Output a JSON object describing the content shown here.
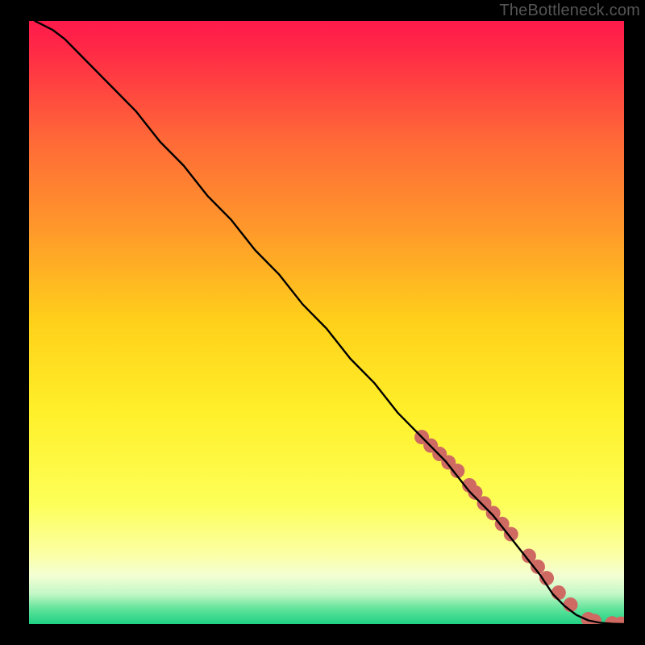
{
  "watermark": "TheBottleneck.com",
  "chart_data": {
    "type": "line",
    "title": "",
    "xlabel": "",
    "ylabel": "",
    "xlim": [
      0,
      100
    ],
    "ylim": [
      0,
      100
    ],
    "gradient_stops": [
      {
        "offset": 0,
        "color": "#ff1a4b"
      },
      {
        "offset": 0.05,
        "color": "#ff2a46"
      },
      {
        "offset": 0.2,
        "color": "#ff6a37"
      },
      {
        "offset": 0.35,
        "color": "#ff9a2a"
      },
      {
        "offset": 0.5,
        "color": "#ffd11a"
      },
      {
        "offset": 0.65,
        "color": "#fff02a"
      },
      {
        "offset": 0.8,
        "color": "#fdff58"
      },
      {
        "offset": 0.88,
        "color": "#fcffa0"
      },
      {
        "offset": 0.92,
        "color": "#f3ffd4"
      },
      {
        "offset": 0.95,
        "color": "#c4f7c6"
      },
      {
        "offset": 0.975,
        "color": "#5fe39a"
      },
      {
        "offset": 1.0,
        "color": "#1fd184"
      }
    ],
    "series": [
      {
        "name": "curve",
        "type": "line",
        "x": [
          1,
          2,
          4,
          6,
          8,
          10,
          14,
          18,
          22,
          26,
          30,
          34,
          38,
          42,
          46,
          50,
          54,
          58,
          62,
          66,
          70,
          74,
          78,
          82,
          86,
          88,
          90,
          92,
          94,
          96,
          98,
          100
        ],
        "y": [
          100,
          99.5,
          98.5,
          97,
          95,
          93,
          89,
          85,
          80,
          76,
          71,
          67,
          62,
          58,
          53,
          49,
          44,
          40,
          35,
          31,
          27,
          22,
          18,
          13,
          8,
          5,
          3,
          1.5,
          0.6,
          0.2,
          0.05,
          0
        ]
      },
      {
        "name": "dots",
        "type": "scatter",
        "color": "#cf6a63",
        "radius": 9,
        "x": [
          66,
          67.5,
          69,
          70.5,
          72,
          74,
          75,
          76.5,
          78,
          79.5,
          81,
          84,
          85.5,
          87,
          89,
          91,
          94,
          95,
          98,
          99.5
        ],
        "y": [
          31,
          29.6,
          28.2,
          26.8,
          25.4,
          23.0,
          21.8,
          20.0,
          18.4,
          16.6,
          14.9,
          11.3,
          9.5,
          7.6,
          5.2,
          3.2,
          0.8,
          0.5,
          0.1,
          0.05
        ]
      }
    ]
  }
}
